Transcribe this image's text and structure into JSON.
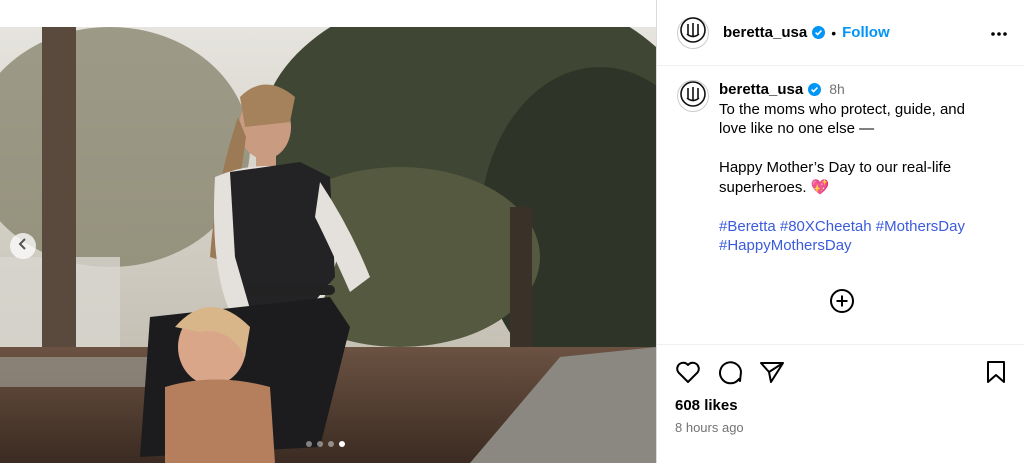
{
  "post": {
    "username": "beretta_usa",
    "follow_label": "Follow",
    "separator": "•",
    "time_short": "8h",
    "caption_line1": "To the moms who protect, guide, and",
    "caption_line2": "love like no one else —",
    "caption_line3": "Happy Mother’s Day to our real-life",
    "caption_line4": "superheroes. 💖",
    "hashtags_line1": "#Beretta #80XCheetah #MothersDay",
    "hashtags_line2": "#HappyMothersDay",
    "likes": "608 likes",
    "time_long": "8 hours ago",
    "carousel": {
      "count": 4,
      "active_index": 3
    }
  },
  "icons": {
    "avatar": "beretta-logo-icon",
    "verified": "verified-badge-icon",
    "more": "more-options-icon",
    "add_comment": "add-comment-icon",
    "like": "heart-icon",
    "comment": "comment-icon",
    "share": "share-icon",
    "save": "bookmark-icon",
    "prev": "chevron-left-icon"
  },
  "colors": {
    "follow": "#0095f6",
    "verified": "#0095f6",
    "hashtag": "#3b5bdb"
  }
}
